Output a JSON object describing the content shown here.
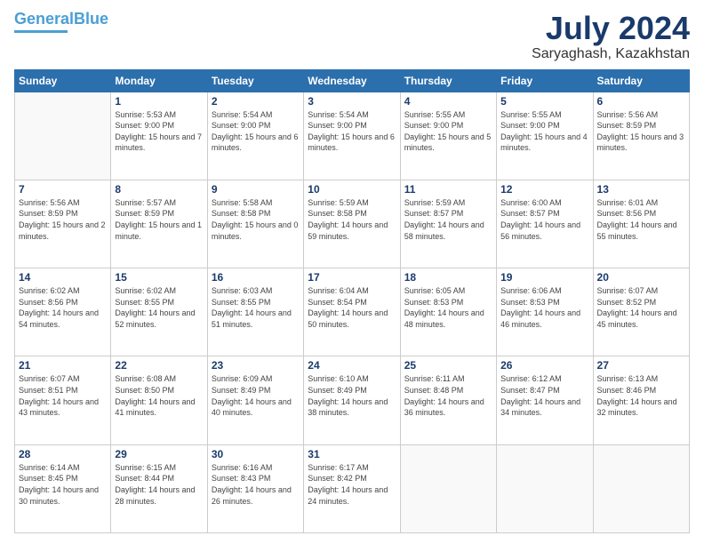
{
  "logo": {
    "line1": "General",
    "line2": "Blue"
  },
  "header": {
    "month_year": "July 2024",
    "location": "Saryaghash, Kazakhstan"
  },
  "days_of_week": [
    "Sunday",
    "Monday",
    "Tuesday",
    "Wednesday",
    "Thursday",
    "Friday",
    "Saturday"
  ],
  "weeks": [
    [
      {
        "day": "",
        "sunrise": "",
        "sunset": "",
        "daylight": ""
      },
      {
        "day": "1",
        "sunrise": "Sunrise: 5:53 AM",
        "sunset": "Sunset: 9:00 PM",
        "daylight": "Daylight: 15 hours and 7 minutes."
      },
      {
        "day": "2",
        "sunrise": "Sunrise: 5:54 AM",
        "sunset": "Sunset: 9:00 PM",
        "daylight": "Daylight: 15 hours and 6 minutes."
      },
      {
        "day": "3",
        "sunrise": "Sunrise: 5:54 AM",
        "sunset": "Sunset: 9:00 PM",
        "daylight": "Daylight: 15 hours and 6 minutes."
      },
      {
        "day": "4",
        "sunrise": "Sunrise: 5:55 AM",
        "sunset": "Sunset: 9:00 PM",
        "daylight": "Daylight: 15 hours and 5 minutes."
      },
      {
        "day": "5",
        "sunrise": "Sunrise: 5:55 AM",
        "sunset": "Sunset: 9:00 PM",
        "daylight": "Daylight: 15 hours and 4 minutes."
      },
      {
        "day": "6",
        "sunrise": "Sunrise: 5:56 AM",
        "sunset": "Sunset: 8:59 PM",
        "daylight": "Daylight: 15 hours and 3 minutes."
      }
    ],
    [
      {
        "day": "7",
        "sunrise": "Sunrise: 5:56 AM",
        "sunset": "Sunset: 8:59 PM",
        "daylight": "Daylight: 15 hours and 2 minutes."
      },
      {
        "day": "8",
        "sunrise": "Sunrise: 5:57 AM",
        "sunset": "Sunset: 8:59 PM",
        "daylight": "Daylight: 15 hours and 1 minute."
      },
      {
        "day": "9",
        "sunrise": "Sunrise: 5:58 AM",
        "sunset": "Sunset: 8:58 PM",
        "daylight": "Daylight: 15 hours and 0 minutes."
      },
      {
        "day": "10",
        "sunrise": "Sunrise: 5:59 AM",
        "sunset": "Sunset: 8:58 PM",
        "daylight": "Daylight: 14 hours and 59 minutes."
      },
      {
        "day": "11",
        "sunrise": "Sunrise: 5:59 AM",
        "sunset": "Sunset: 8:57 PM",
        "daylight": "Daylight: 14 hours and 58 minutes."
      },
      {
        "day": "12",
        "sunrise": "Sunrise: 6:00 AM",
        "sunset": "Sunset: 8:57 PM",
        "daylight": "Daylight: 14 hours and 56 minutes."
      },
      {
        "day": "13",
        "sunrise": "Sunrise: 6:01 AM",
        "sunset": "Sunset: 8:56 PM",
        "daylight": "Daylight: 14 hours and 55 minutes."
      }
    ],
    [
      {
        "day": "14",
        "sunrise": "Sunrise: 6:02 AM",
        "sunset": "Sunset: 8:56 PM",
        "daylight": "Daylight: 14 hours and 54 minutes."
      },
      {
        "day": "15",
        "sunrise": "Sunrise: 6:02 AM",
        "sunset": "Sunset: 8:55 PM",
        "daylight": "Daylight: 14 hours and 52 minutes."
      },
      {
        "day": "16",
        "sunrise": "Sunrise: 6:03 AM",
        "sunset": "Sunset: 8:55 PM",
        "daylight": "Daylight: 14 hours and 51 minutes."
      },
      {
        "day": "17",
        "sunrise": "Sunrise: 6:04 AM",
        "sunset": "Sunset: 8:54 PM",
        "daylight": "Daylight: 14 hours and 50 minutes."
      },
      {
        "day": "18",
        "sunrise": "Sunrise: 6:05 AM",
        "sunset": "Sunset: 8:53 PM",
        "daylight": "Daylight: 14 hours and 48 minutes."
      },
      {
        "day": "19",
        "sunrise": "Sunrise: 6:06 AM",
        "sunset": "Sunset: 8:53 PM",
        "daylight": "Daylight: 14 hours and 46 minutes."
      },
      {
        "day": "20",
        "sunrise": "Sunrise: 6:07 AM",
        "sunset": "Sunset: 8:52 PM",
        "daylight": "Daylight: 14 hours and 45 minutes."
      }
    ],
    [
      {
        "day": "21",
        "sunrise": "Sunrise: 6:07 AM",
        "sunset": "Sunset: 8:51 PM",
        "daylight": "Daylight: 14 hours and 43 minutes."
      },
      {
        "day": "22",
        "sunrise": "Sunrise: 6:08 AM",
        "sunset": "Sunset: 8:50 PM",
        "daylight": "Daylight: 14 hours and 41 minutes."
      },
      {
        "day": "23",
        "sunrise": "Sunrise: 6:09 AM",
        "sunset": "Sunset: 8:49 PM",
        "daylight": "Daylight: 14 hours and 40 minutes."
      },
      {
        "day": "24",
        "sunrise": "Sunrise: 6:10 AM",
        "sunset": "Sunset: 8:49 PM",
        "daylight": "Daylight: 14 hours and 38 minutes."
      },
      {
        "day": "25",
        "sunrise": "Sunrise: 6:11 AM",
        "sunset": "Sunset: 8:48 PM",
        "daylight": "Daylight: 14 hours and 36 minutes."
      },
      {
        "day": "26",
        "sunrise": "Sunrise: 6:12 AM",
        "sunset": "Sunset: 8:47 PM",
        "daylight": "Daylight: 14 hours and 34 minutes."
      },
      {
        "day": "27",
        "sunrise": "Sunrise: 6:13 AM",
        "sunset": "Sunset: 8:46 PM",
        "daylight": "Daylight: 14 hours and 32 minutes."
      }
    ],
    [
      {
        "day": "28",
        "sunrise": "Sunrise: 6:14 AM",
        "sunset": "Sunset: 8:45 PM",
        "daylight": "Daylight: 14 hours and 30 minutes."
      },
      {
        "day": "29",
        "sunrise": "Sunrise: 6:15 AM",
        "sunset": "Sunset: 8:44 PM",
        "daylight": "Daylight: 14 hours and 28 minutes."
      },
      {
        "day": "30",
        "sunrise": "Sunrise: 6:16 AM",
        "sunset": "Sunset: 8:43 PM",
        "daylight": "Daylight: 14 hours and 26 minutes."
      },
      {
        "day": "31",
        "sunrise": "Sunrise: 6:17 AM",
        "sunset": "Sunset: 8:42 PM",
        "daylight": "Daylight: 14 hours and 24 minutes."
      },
      {
        "day": "",
        "sunrise": "",
        "sunset": "",
        "daylight": ""
      },
      {
        "day": "",
        "sunrise": "",
        "sunset": "",
        "daylight": ""
      },
      {
        "day": "",
        "sunrise": "",
        "sunset": "",
        "daylight": ""
      }
    ]
  ]
}
